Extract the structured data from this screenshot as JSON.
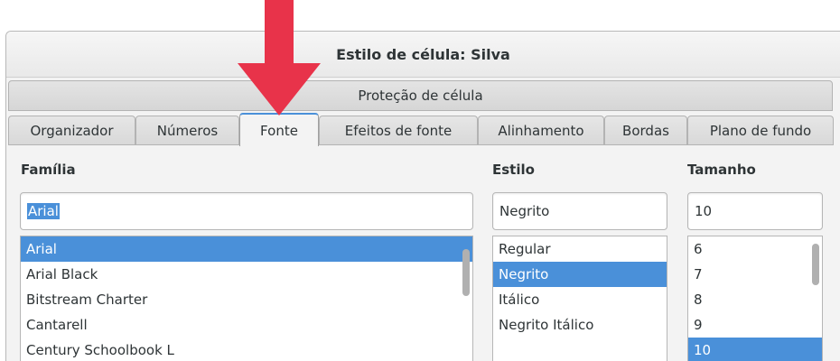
{
  "window": {
    "title": "Estilo de célula: Silva"
  },
  "tabs_row1": [
    {
      "label": "Proteção de célula"
    }
  ],
  "tabs_row2": [
    {
      "label": "Organizador"
    },
    {
      "label": "Números"
    },
    {
      "label": "Fonte",
      "active": true
    },
    {
      "label": "Efeitos de fonte"
    },
    {
      "label": "Alinhamento"
    },
    {
      "label": "Bordas"
    },
    {
      "label": "Plano de fundo"
    }
  ],
  "font": {
    "family": {
      "label": "Família",
      "value": "Arial",
      "items": [
        "Arial",
        "Arial Black",
        "Bitstream Charter",
        "Cantarell",
        "Century Schoolbook L"
      ],
      "selected": "Arial"
    },
    "style": {
      "label": "Estilo",
      "value": "Negrito",
      "items": [
        "Regular",
        "Negrito",
        "Itálico",
        "Negrito Itálico"
      ],
      "selected": "Negrito"
    },
    "size": {
      "label": "Tamanho",
      "value": "10",
      "items": [
        "6",
        "7",
        "8",
        "9",
        "10"
      ],
      "selected": "10"
    }
  },
  "annotation": {
    "arrow_color": "#e8334a",
    "points_to": "Fonte"
  },
  "colors": {
    "selection": "#4a90d9",
    "active_tab_accent": "#4a90d9"
  }
}
